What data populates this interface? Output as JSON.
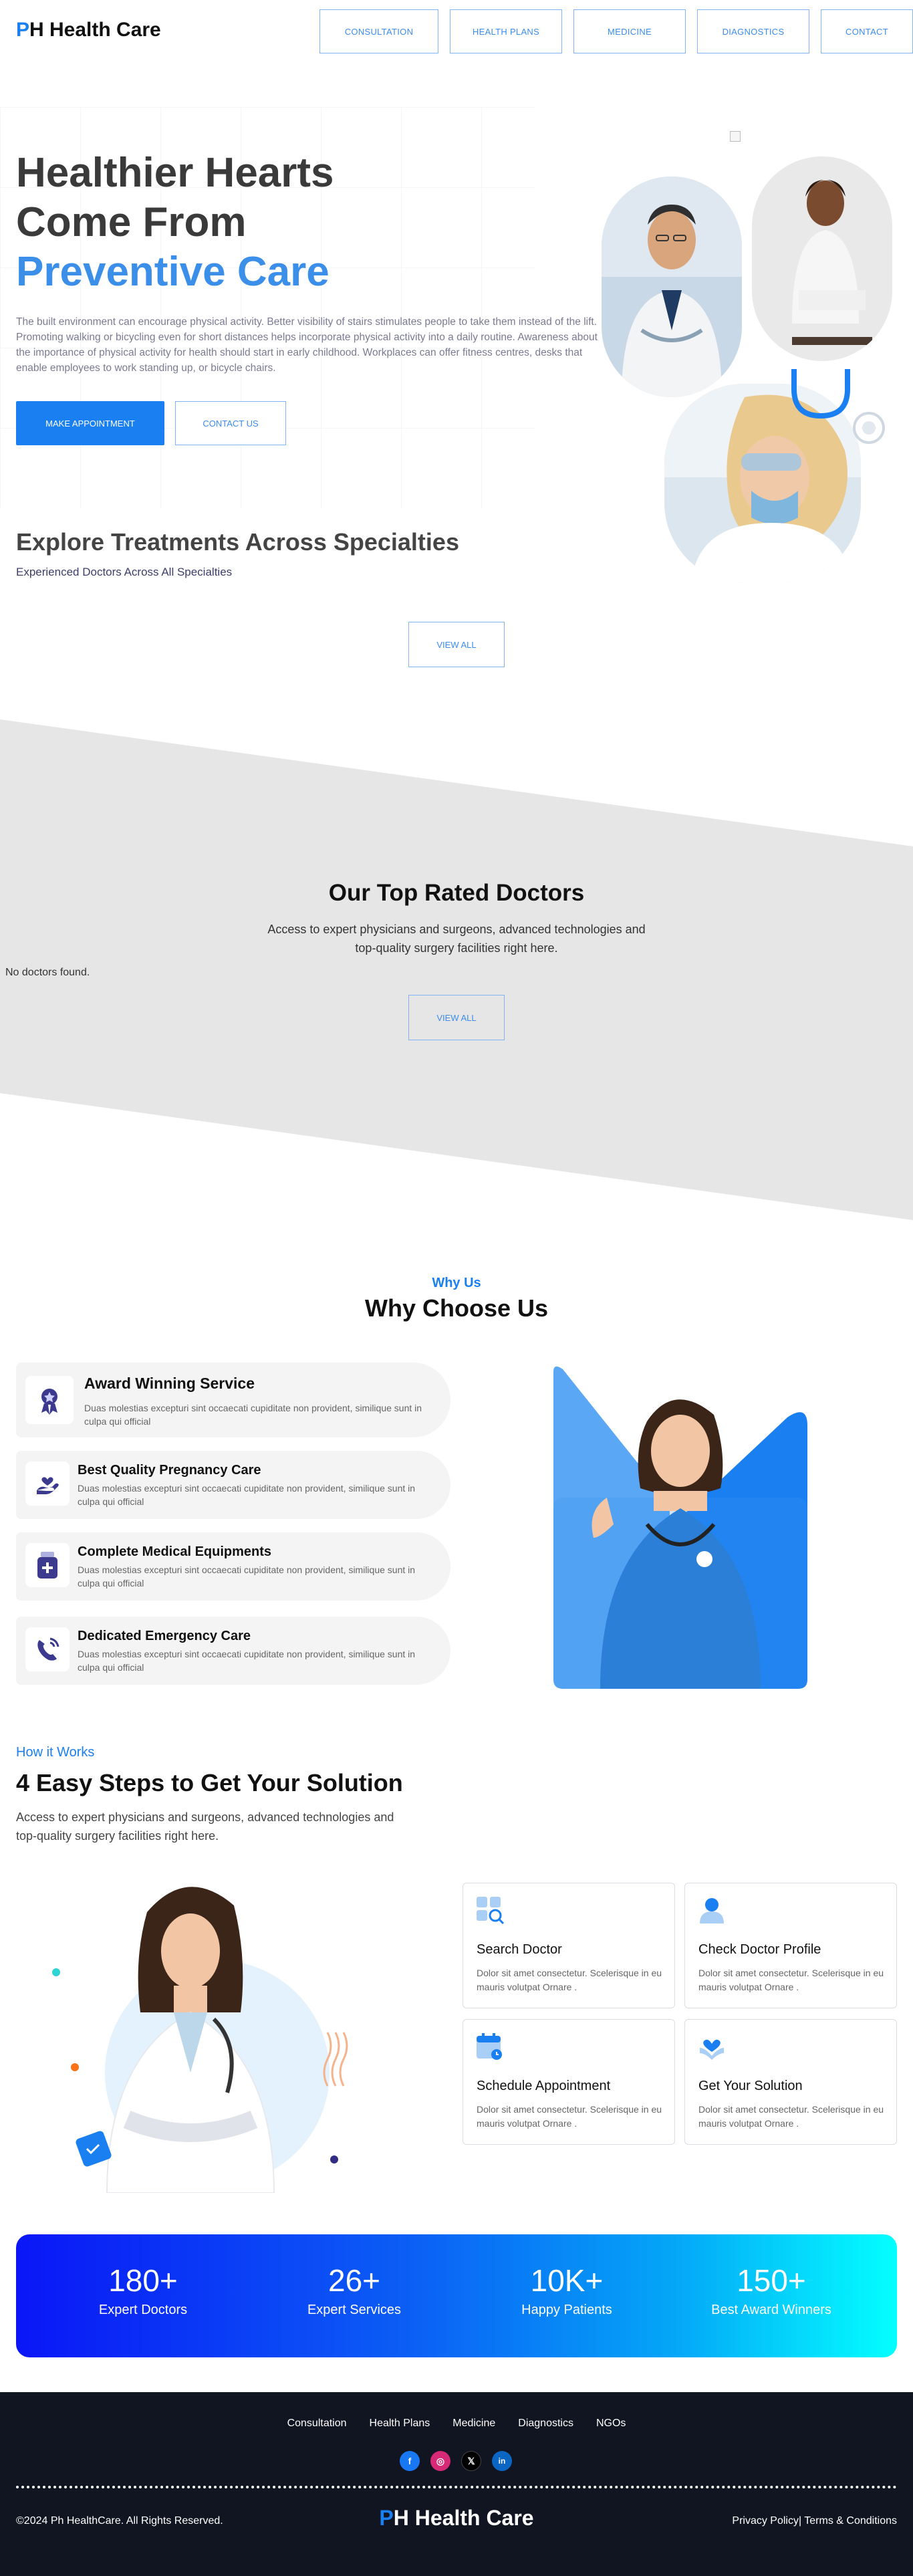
{
  "header": {
    "logo_p": "P",
    "logo_rest": "H Health Care",
    "nav": [
      "CONSULTATION",
      "HEALTH PLANS",
      "MEDICINE",
      "DIAGNOSTICS",
      "CONTACT"
    ]
  },
  "hero": {
    "title_line1": "Healthier Hearts",
    "title_line2": "Come From",
    "title_line3": "Preventive Care",
    "text": "The built environment can encourage physical activity. Better visibility of stairs stimulates people to take them instead of the lift. Promoting walking or bicycling even for short distances helps incorporate physical activity into a daily routine. Awareness about the importance of physical activity for health should start in early childhood. Workplaces can offer fitness centres, desks that enable employees to work standing up, or bicycle chairs.",
    "primary_button": "MAKE APPOINTMENT",
    "secondary_button": "CONTACT US"
  },
  "explore": {
    "title": "Explore Treatments Across Specialties",
    "subtitle": "Experienced Doctors Across All Specialties",
    "view_all": "VIEW ALL"
  },
  "top_doctors": {
    "title": "Our Top Rated Doctors",
    "description": "Access to expert physicians and surgeons, advanced technologies and top-quality surgery facilities right here.",
    "empty_message": "No doctors found.",
    "view_all": "VIEW ALL"
  },
  "why": {
    "eyebrow": "Why Us",
    "title": "Why Choose Us",
    "features": [
      {
        "title": "Award Winning Service",
        "text": "Duas molestias excepturi sint occaecati cupiditate non provident, similique sunt in culpa qui official",
        "icon": "award-icon"
      },
      {
        "title": "Best Quality Pregnancy Care",
        "text": "Duas molestias excepturi sint occaecati cupiditate non provident, similique sunt in culpa qui official",
        "icon": "pregnancy-care-icon"
      },
      {
        "title": "Complete Medical Equipments",
        "text": "Duas molestias excepturi sint occaecati cupiditate non provident, similique sunt in culpa qui official",
        "icon": "medicine-bottle-icon"
      },
      {
        "title": "Dedicated Emergency Care",
        "text": "Duas molestias excepturi sint occaecati cupiditate non provident, similique sunt in culpa qui official",
        "icon": "emergency-phone-icon"
      }
    ]
  },
  "how": {
    "eyebrow": "How it Works",
    "title": "4 Easy Steps to Get Your Solution",
    "description": "Access to expert physicians and surgeons, advanced technologies and top-quality surgery facilities right here.",
    "steps": [
      {
        "title": "Search Doctor",
        "text": "Dolor sit amet consectetur. Scelerisque in eu mauris volutpat Ornare .",
        "icon": "search-doctor-icon"
      },
      {
        "title": "Check Doctor Profile",
        "text": "Dolor sit amet consectetur. Scelerisque in eu mauris volutpat Ornare .",
        "icon": "doctor-profile-icon"
      },
      {
        "title": "Schedule Appointment",
        "text": "Dolor sit amet consectetur. Scelerisque in eu mauris volutpat Ornare .",
        "icon": "calendar-icon"
      },
      {
        "title": "Get Your Solution",
        "text": "Dolor sit amet consectetur. Scelerisque in eu mauris volutpat Ornare .",
        "icon": "heart-hand-icon"
      }
    ]
  },
  "stats": [
    {
      "value": "180+",
      "label": "Expert Doctors"
    },
    {
      "value": "26+",
      "label": "Expert Services"
    },
    {
      "value": "10K+",
      "label": "Happy Patients"
    },
    {
      "value": "150+",
      "label": "Best Award Winners"
    }
  ],
  "footer": {
    "links": [
      "Consultation",
      "Health Plans",
      "Medicine",
      "Diagnostics",
      "NGOs"
    ],
    "social": [
      {
        "icon": "facebook-icon",
        "glyph": "f",
        "color": "#1877f2"
      },
      {
        "icon": "instagram-icon",
        "glyph": "◎",
        "color": "#d62976"
      },
      {
        "icon": "x-icon",
        "glyph": "𝕏",
        "color": "#000000"
      },
      {
        "icon": "linkedin-icon",
        "glyph": "in",
        "color": "#0a66c2"
      }
    ],
    "copyright": "©2024 Ph HealthCare. All Rights Reserved.",
    "logo_p": "P",
    "logo_rest": "H Health Care",
    "legal": "Privacy Policy| Terms & Conditions"
  },
  "colors": {
    "accent": "#1a7ff0",
    "footer_bg": "#111421",
    "band_bg": "#e6e6e6"
  }
}
